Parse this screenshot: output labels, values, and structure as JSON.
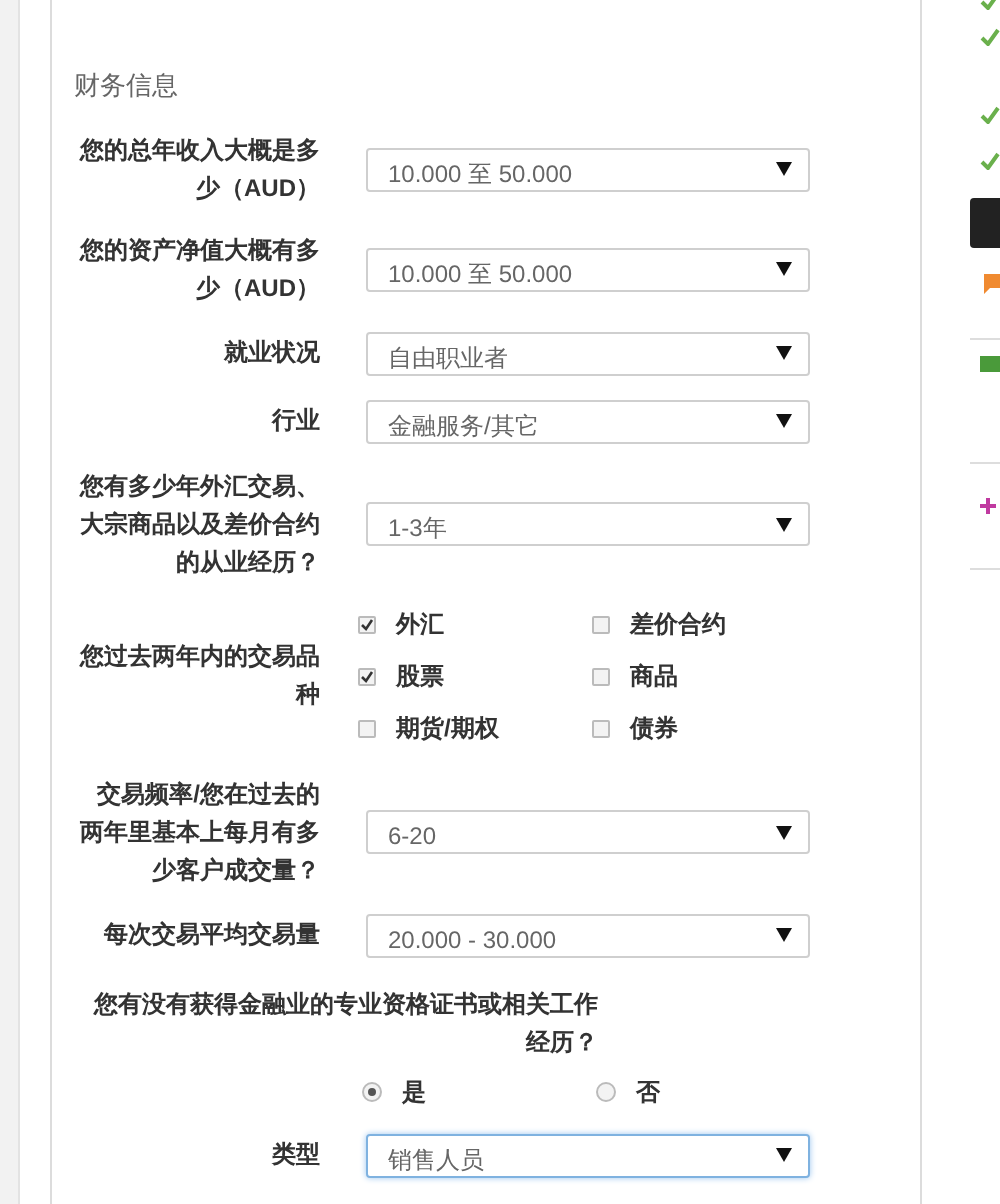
{
  "section_title": "财务信息",
  "fields": [
    {
      "kind": "select",
      "label": "您的总年收入大概是多少（AUD）",
      "value": "10.000 至 50.000",
      "focused": false
    },
    {
      "kind": "select",
      "label": "您的资产净值大概有多少（AUD）",
      "value": "10.000 至 50.000",
      "focused": false
    },
    {
      "kind": "select",
      "label": "就业状况",
      "value": "自由职业者",
      "focused": false
    },
    {
      "kind": "select",
      "label": "行业",
      "value": "金融服务/其它",
      "focused": false
    },
    {
      "kind": "select",
      "label": "您有多少年外汇交易、大宗商品以及差价合约的从业经历？",
      "value": "1-3年",
      "focused": false
    },
    {
      "kind": "checkboxes",
      "label": "您过去两年内的交易品种",
      "options": [
        {
          "label": "外汇",
          "checked": true
        },
        {
          "label": "差价合约",
          "checked": false
        },
        {
          "label": "股票",
          "checked": true
        },
        {
          "label": "商品",
          "checked": false
        },
        {
          "label": "期货/期权",
          "checked": false
        },
        {
          "label": "债券",
          "checked": false
        }
      ]
    },
    {
      "kind": "select",
      "label": "交易频率/您在过去的两年里基本上每月有多少客户成交量？",
      "value": "6-20",
      "focused": false
    },
    {
      "kind": "select",
      "label": "每次交易平均交易量",
      "value": "20.000 - 30.000",
      "focused": false
    },
    {
      "kind": "radio",
      "label": "您有没有获得金融业的专业资格证书或相关工作经历？",
      "options": [
        {
          "label": "是",
          "selected": true
        },
        {
          "label": "否",
          "selected": false
        }
      ]
    },
    {
      "kind": "select",
      "label": "类型",
      "value": "销售人员",
      "focused": true
    }
  ]
}
